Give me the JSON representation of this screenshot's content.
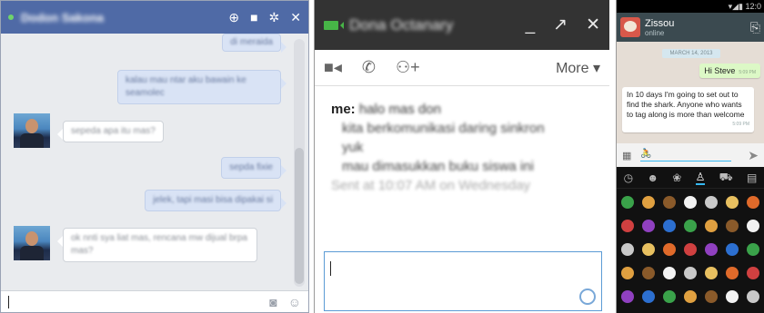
{
  "fb": {
    "title": "Dodon Sakona",
    "header_icons": [
      "add-friend-icon",
      "video-icon",
      "gear-icon",
      "close-icon"
    ],
    "messages": [
      {
        "dir": "out",
        "text": "di meraida"
      },
      {
        "dir": "out",
        "text": "kalau mau ntar aku bawain ke seamolec"
      },
      {
        "dir": "in",
        "text": "sepeda apa itu mas?"
      },
      {
        "dir": "out",
        "text": "sepda fixie"
      },
      {
        "dir": "out",
        "text": "jelek, tapi masi bisa dipakai si"
      },
      {
        "dir": "in",
        "text": "ok nnti sya liat mas, rencana mw dijual brpa mas?"
      }
    ],
    "footer_icons": [
      "camera-icon",
      "smiley-icon"
    ],
    "colors": {
      "header": "#4f6aa6",
      "out_bubble": "#d9e3f5"
    }
  },
  "gmail": {
    "title": "Dona Octanary",
    "window_icons": [
      "minimize-icon",
      "popout-icon",
      "close-icon"
    ],
    "toolbar_icons": [
      "video-icon",
      "phone-icon",
      "add-person-icon"
    ],
    "more_label": "More ▾",
    "sender": "me:",
    "first_line": "halo mas don",
    "lines": [
      "kita berkomunikasi daring sinkron",
      "yuk",
      "mau dimasukkan buku siswa ini"
    ],
    "sent_text": "Sent at 10:07 AM on Wednesday",
    "colors": {
      "header": "#333333",
      "video": "#47b547"
    }
  },
  "whatsapp": {
    "status_time": "12:0",
    "contact": "Zissou",
    "presence": "online",
    "date_label": "MARCH 14, 2013",
    "out_message": "Hi Steve",
    "out_time": "5:09 PM",
    "in_message": "In 10 days I'm going to set out to find the shark. Anyone who wants to tag along is more than welcome",
    "in_time": "5:09 PM",
    "kb_tabs": [
      "clock-icon",
      "smiley-icon",
      "flower-icon",
      "bell-icon",
      "car-icon",
      "symbols-icon"
    ],
    "colors": {
      "header": "#3b4a50",
      "out_bubble": "#dcf8c6",
      "accent": "#34b7f1"
    }
  }
}
